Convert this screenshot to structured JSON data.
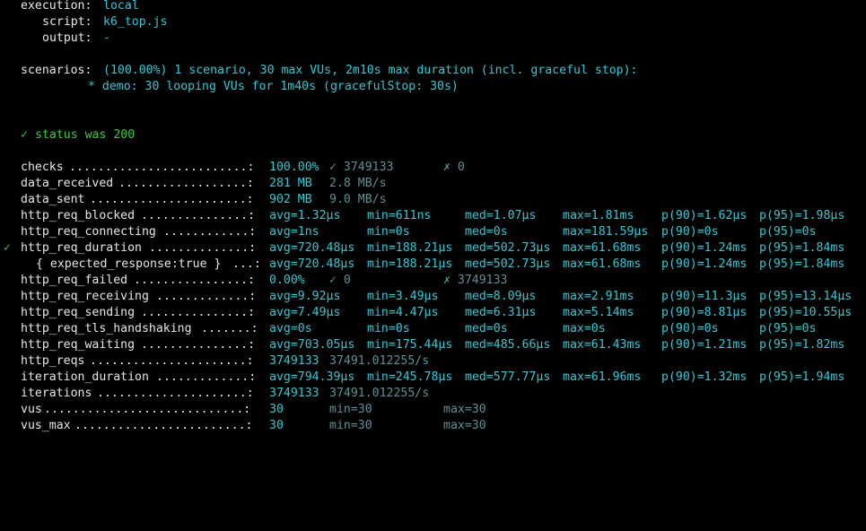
{
  "header": {
    "execution_label": "execution:",
    "execution_value": "local",
    "script_label": "script:",
    "script_value": "k6_top.js",
    "output_label": "output:",
    "output_value": "-"
  },
  "scenarios": {
    "label": "scenarios:",
    "summary": "(100.00%) 1 scenario, 30 max VUs, 2m10s max duration (incl. graceful stop):",
    "detail": "* demo: 30 looping VUs for 1m40s (gracefulStop: 30s)"
  },
  "check": {
    "mark": "✓",
    "text": "status was 200"
  },
  "metrics": {
    "checks": {
      "name": "checks",
      "dots": ".........................:",
      "value": "100.00%",
      "pass": "✓ 3749133",
      "fail": "✗ 0"
    },
    "data_received": {
      "name": "data_received",
      "dots": "..................:",
      "value": "281 MB",
      "rate": "2.8 MB/s"
    },
    "data_sent": {
      "name": "data_sent",
      "dots": "......................:",
      "value": "902 MB",
      "rate": "9.0 MB/s"
    },
    "http_req_blocked": {
      "name": "http_req_blocked",
      "dots": "...............:",
      "avg": "avg=1.32µs",
      "min": "min=611ns",
      "med": "med=1.07µs",
      "max": "max=1.81ms",
      "p90": "p(90)=1.62µs",
      "p95": "p(95)=1.98µs"
    },
    "http_req_connecting": {
      "name": "http_req_connecting",
      "dots": "............:",
      "avg": "avg=1ns",
      "min": "min=0s",
      "med": "med=0s",
      "max": "max=181.59µs",
      "p90": "p(90)=0s",
      "p95": "p(95)=0s"
    },
    "http_req_duration": {
      "mark": "✓",
      "name": "http_req_duration",
      "dots": "..............:",
      "avg": "avg=720.48µs",
      "min": "min=188.21µs",
      "med": "med=502.73µs",
      "max": "max=61.68ms",
      "p90": "p(90)=1.24ms",
      "p95": "p(95)=1.84ms"
    },
    "expected_response": {
      "name": "{ expected_response:true }",
      "dots": "...:",
      "avg": "avg=720.48µs",
      "min": "min=188.21µs",
      "med": "med=502.73µs",
      "max": "max=61.68ms",
      "p90": "p(90)=1.24ms",
      "p95": "p(95)=1.84ms"
    },
    "http_req_failed": {
      "name": "http_req_failed",
      "dots": "................:",
      "value": "0.00%",
      "pass": "✓ 0",
      "fail": "✗ 3749133"
    },
    "http_req_receiving": {
      "name": "http_req_receiving",
      "dots": ".............:",
      "avg": "avg=9.92µs",
      "min": "min=3.49µs",
      "med": "med=8.09µs",
      "max": "max=2.91ms",
      "p90": "p(90)=11.3µs",
      "p95": "p(95)=13.14µs"
    },
    "http_req_sending": {
      "name": "http_req_sending",
      "dots": "...............:",
      "avg": "avg=7.49µs",
      "min": "min=4.47µs",
      "med": "med=6.31µs",
      "max": "max=5.14ms",
      "p90": "p(90)=8.81µs",
      "p95": "p(95)=10.55µs"
    },
    "http_req_tls_handshaking": {
      "name": "http_req_tls_handshaking",
      "dots": ".......:",
      "avg": "avg=0s",
      "min": "min=0s",
      "med": "med=0s",
      "max": "max=0s",
      "p90": "p(90)=0s",
      "p95": "p(95)=0s"
    },
    "http_req_waiting": {
      "name": "http_req_waiting",
      "dots": "...............:",
      "avg": "avg=703.05µs",
      "min": "min=175.44µs",
      "med": "med=485.66µs",
      "max": "max=61.43ms",
      "p90": "p(90)=1.21ms",
      "p95": "p(95)=1.82ms"
    },
    "http_reqs": {
      "name": "http_reqs",
      "dots": "......................:",
      "value": "3749133",
      "rate": "37491.012255/s"
    },
    "iteration_duration": {
      "name": "iteration_duration",
      "dots": ".............:",
      "avg": "avg=794.39µs",
      "min": "min=245.78µs",
      "med": "med=577.77µs",
      "max": "max=61.96ms",
      "p90": "p(90)=1.32ms",
      "p95": "p(95)=1.94ms"
    },
    "iterations": {
      "name": "iterations",
      "dots": ".....................:",
      "value": "3749133",
      "rate": "37491.012255/s"
    },
    "vus": {
      "name": "vus",
      "dots": "............................:",
      "value": "30",
      "min": "min=30",
      "max": "max=30"
    },
    "vus_max": {
      "name": "vus_max",
      "dots": "........................:",
      "value": "30",
      "min": "min=30",
      "max": "max=30"
    }
  },
  "colors": {
    "background": "#000000",
    "text": "#e6e6e6",
    "cyan": "#35c7d4",
    "dim_cyan": "#5f8f95",
    "green": "#3fc93f"
  }
}
